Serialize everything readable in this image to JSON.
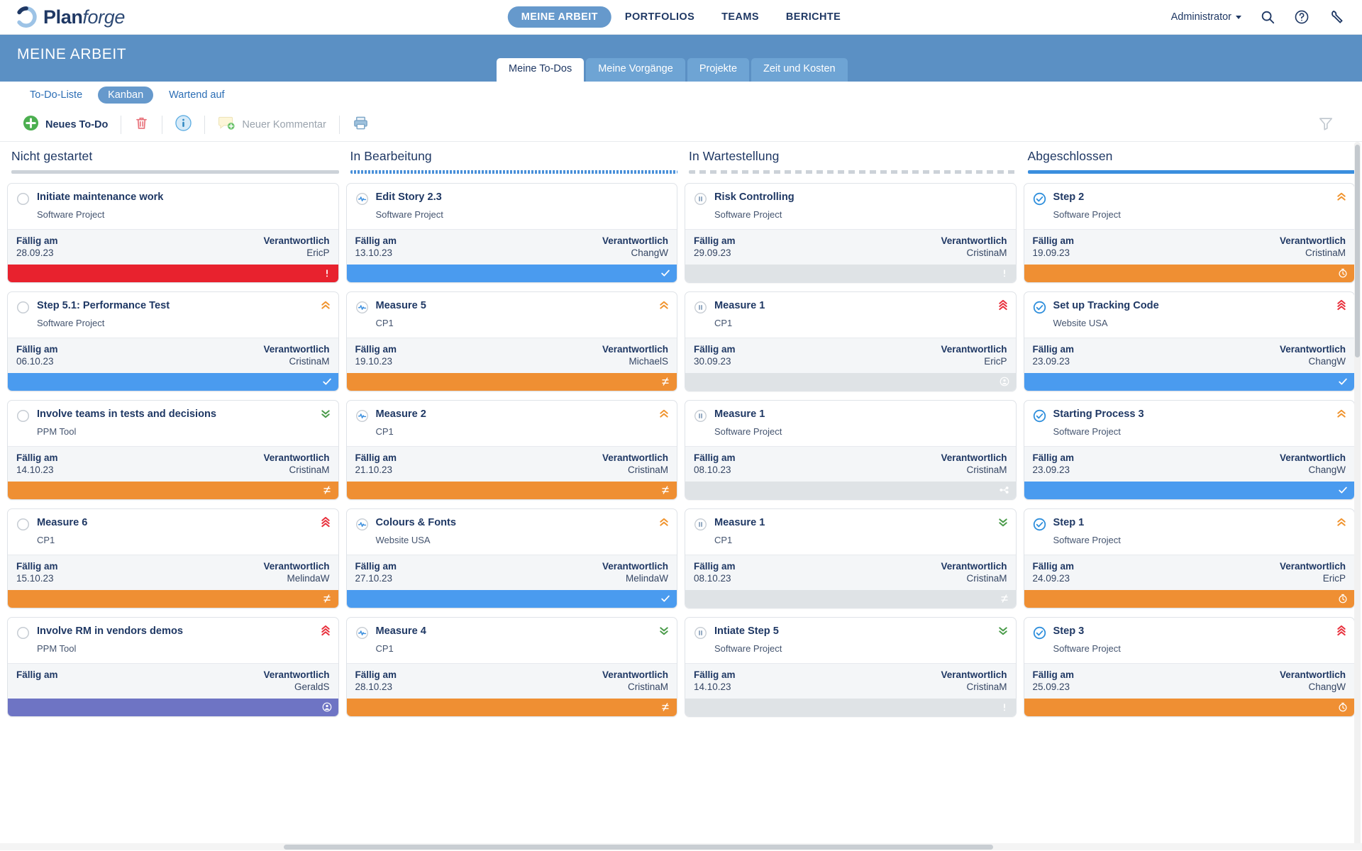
{
  "brand": {
    "name_bold": "Plan",
    "name_light": "forge",
    "logo_icon": "circular-arrow-icon"
  },
  "topnav": {
    "items": [
      {
        "label": "MEINE ARBEIT",
        "active": true
      },
      {
        "label": "PORTFOLIOS",
        "active": false
      },
      {
        "label": "TEAMS",
        "active": false
      },
      {
        "label": "BERICHTE",
        "active": false
      }
    ],
    "user": "Administrator",
    "icons": [
      "search-icon",
      "help-icon",
      "wrench-icon"
    ]
  },
  "banner": {
    "title": "MEINE ARBEIT"
  },
  "tabs": [
    {
      "label": "Meine To-Dos",
      "active": true
    },
    {
      "label": "Meine Vorgänge",
      "active": false
    },
    {
      "label": "Projekte",
      "active": false
    },
    {
      "label": "Zeit und Kosten",
      "active": false
    }
  ],
  "subnav": [
    {
      "label": "To-Do-Liste",
      "active": false
    },
    {
      "label": "Kanban",
      "active": true
    },
    {
      "label": "Wartend auf",
      "active": false
    }
  ],
  "toolbar": {
    "new_todo": "Neues To-Do",
    "new_comment": "Neuer Kommentar",
    "icons": [
      "plus-circle-icon",
      "trash-icon",
      "info-icon",
      "comment-add-icon",
      "print-icon",
      "filter-icon"
    ]
  },
  "card_labels": {
    "due": "Fällig am",
    "responsible": "Verantwortlich"
  },
  "colors": {
    "accent_blue": "#5b90c4",
    "nav_pill": "#6699cc",
    "red": "#e8222e",
    "blue": "#4a9bef",
    "orange": "#ef8f33",
    "purple": "#6e74c4",
    "gray": "#dfe3e6",
    "prio_red": "#e8303c",
    "prio_orange": "#f0942f",
    "prio_green": "#4a9b4a"
  },
  "columns": [
    {
      "title": "Nicht gestartet",
      "rule": "gray",
      "state_icon": "empty-circle-icon",
      "cards": [
        {
          "title": "Initiate maintenance work",
          "project": "Software Project",
          "due": "28.09.23",
          "who": "EricP",
          "foot_color": "red",
          "foot_glyph": "exclamation-icon",
          "prio": ""
        },
        {
          "title": "Step 5.1: Performance Test",
          "project": "Software Project",
          "due": "06.10.23",
          "who": "CristinaM",
          "foot_color": "blue",
          "foot_glyph": "check-icon",
          "prio": "orange-up"
        },
        {
          "title": "Involve teams in tests and decisions",
          "project": "PPM Tool",
          "due": "14.10.23",
          "who": "CristinaM",
          "foot_color": "orange",
          "foot_glyph": "progress-icon",
          "prio": "green-down"
        },
        {
          "title": "Measure 6",
          "project": "CP1",
          "due": "15.10.23",
          "who": "MelindaW",
          "foot_color": "orange",
          "foot_glyph": "progress-icon",
          "prio": "red-up"
        },
        {
          "title": "Involve RM in vendors demos",
          "project": "PPM Tool",
          "due": "",
          "who": "GeraldS",
          "foot_color": "purple",
          "foot_glyph": "person-icon",
          "prio": "red-up"
        }
      ]
    },
    {
      "title": "In Bearbeitung",
      "rule": "blue-dotted",
      "state_icon": "activity-pulse-icon",
      "cards": [
        {
          "title": "Edit Story 2.3",
          "project": "Software Project",
          "due": "13.10.23",
          "who": "ChangW",
          "foot_color": "blue",
          "foot_glyph": "check-icon",
          "prio": ""
        },
        {
          "title": "Measure 5",
          "project": "CP1",
          "due": "19.10.23",
          "who": "MichaelS",
          "foot_color": "orange",
          "foot_glyph": "progress-icon",
          "prio": "orange-up"
        },
        {
          "title": "Measure 2",
          "project": "CP1",
          "due": "21.10.23",
          "who": "CristinaM",
          "foot_color": "orange",
          "foot_glyph": "progress-icon",
          "prio": "orange-up"
        },
        {
          "title": "Colours & Fonts",
          "project": "Website USA",
          "due": "27.10.23",
          "who": "MelindaW",
          "foot_color": "blue",
          "foot_glyph": "check-icon",
          "prio": "orange-up"
        },
        {
          "title": "Measure 4",
          "project": "CP1",
          "due": "28.10.23",
          "who": "CristinaM",
          "foot_color": "orange",
          "foot_glyph": "progress-icon",
          "prio": "green-down"
        }
      ]
    },
    {
      "title": "In Wartestellung",
      "rule": "gray-dashed",
      "state_icon": "pause-circle-icon",
      "cards": [
        {
          "title": "Risk Controlling",
          "project": "Software Project",
          "due": "29.09.23",
          "who": "CristinaM",
          "foot_color": "gray",
          "foot_glyph": "exclamation-icon",
          "prio": ""
        },
        {
          "title": "Measure 1",
          "project": "CP1",
          "due": "30.09.23",
          "who": "EricP",
          "foot_color": "gray",
          "foot_glyph": "person-icon",
          "prio": "red-up"
        },
        {
          "title": "Measure 1",
          "project": "Software Project",
          "due": "08.10.23",
          "who": "CristinaM",
          "foot_color": "gray",
          "foot_glyph": "share-icon",
          "prio": ""
        },
        {
          "title": "Measure 1",
          "project": "CP1",
          "due": "08.10.23",
          "who": "CristinaM",
          "foot_color": "gray",
          "foot_glyph": "progress-icon",
          "prio": "green-down"
        },
        {
          "title": "Intiate Step 5",
          "project": "Software Project",
          "due": "14.10.23",
          "who": "CristinaM",
          "foot_color": "gray",
          "foot_glyph": "exclamation-icon",
          "prio": "green-down"
        }
      ]
    },
    {
      "title": "Abgeschlossen",
      "rule": "blue",
      "state_icon": "check-circle-icon",
      "cards": [
        {
          "title": "Step 2",
          "project": "Software Project",
          "due": "19.09.23",
          "who": "CristinaM",
          "foot_color": "orange",
          "foot_glyph": "stopwatch-icon",
          "prio": "orange-up"
        },
        {
          "title": "Set up Tracking Code",
          "project": "Website USA",
          "due": "23.09.23",
          "who": "ChangW",
          "foot_color": "blue",
          "foot_glyph": "check-icon",
          "prio": "red-up"
        },
        {
          "title": "Starting Process 3",
          "project": "Software Project",
          "due": "23.09.23",
          "who": "ChangW",
          "foot_color": "blue",
          "foot_glyph": "check-icon",
          "prio": "orange-up"
        },
        {
          "title": "Step 1",
          "project": "Software Project",
          "due": "24.09.23",
          "who": "EricP",
          "foot_color": "orange",
          "foot_glyph": "stopwatch-icon",
          "prio": "orange-up"
        },
        {
          "title": "Step 3",
          "project": "Software Project",
          "due": "25.09.23",
          "who": "ChangW",
          "foot_color": "orange",
          "foot_glyph": "stopwatch-icon",
          "prio": "red-up"
        }
      ]
    }
  ]
}
